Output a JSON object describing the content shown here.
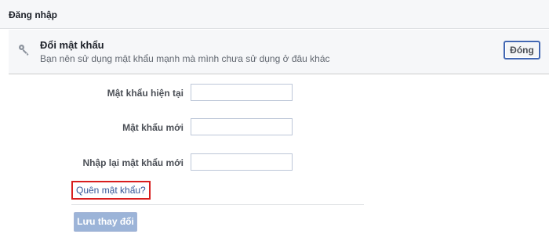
{
  "header": {
    "title": "Đăng nhập"
  },
  "section": {
    "icon": "key-icon",
    "title": "Đổi mật khẩu",
    "subtitle": "Bạn nên sử dụng mật khẩu mạnh mà mình chưa sử dụng ở đâu khác",
    "close_label": "Đóng"
  },
  "form": {
    "fields": [
      {
        "label": "Mật khẩu hiện tại",
        "value": "",
        "placeholder": ""
      },
      {
        "label": "Mật khẩu mới",
        "value": "",
        "placeholder": ""
      },
      {
        "label": "Nhập lại mật khẩu mới",
        "value": "",
        "placeholder": ""
      }
    ],
    "forgot_link": "Quên mật khẩu?",
    "save_label": "Lưu thay đổi"
  },
  "colors": {
    "link": "#365899",
    "highlight_border": "#d81e1e",
    "close_border": "#4267b2",
    "save_button_disabled": "#9cb4d8"
  }
}
